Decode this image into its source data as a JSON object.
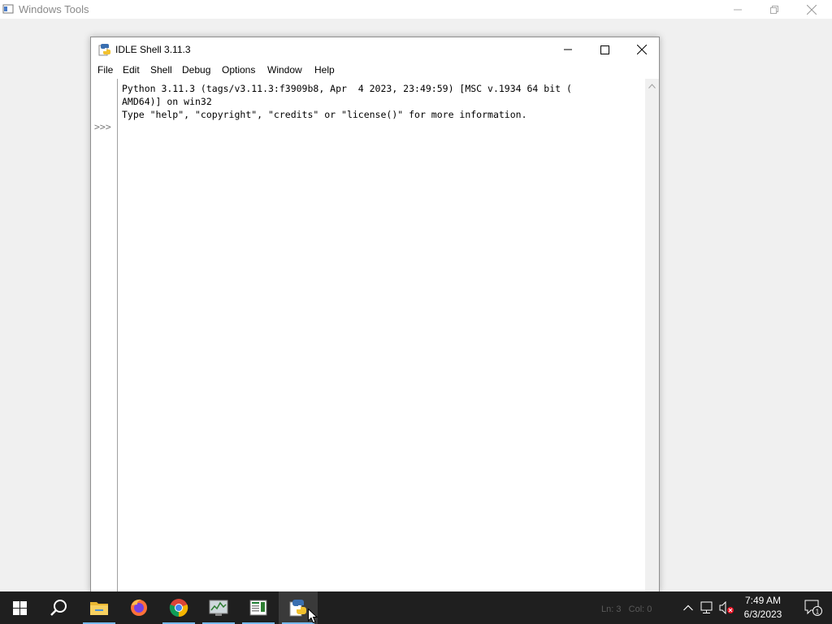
{
  "background_window": {
    "title": "Windows Tools",
    "icon": "windows-tools-icon"
  },
  "idle": {
    "title": "IDLE Shell 3.11.3",
    "icon": "python-idle-icon",
    "menu": [
      "File",
      "Edit",
      "Shell",
      "Debug",
      "Options",
      "Window",
      "Help"
    ],
    "prompt": ">>>",
    "output": "Python 3.11.3 (tags/v3.11.3:f3909b8, Apr  4 2023, 23:49:59) [MSC v.1934 64 bit (\nAMD64)] on win32\nType \"help\", \"copyright\", \"credits\" or \"license()\" for more information.",
    "status_ln": "Ln: 3",
    "status_col": "Col: 0"
  },
  "taskbar": {
    "apps": [
      {
        "name": "start",
        "icon": "windows-logo-icon"
      },
      {
        "name": "search",
        "icon": "search-icon"
      },
      {
        "name": "file-explorer",
        "icon": "folder-icon"
      },
      {
        "name": "firefox",
        "icon": "firefox-icon"
      },
      {
        "name": "chrome",
        "icon": "chrome-icon"
      },
      {
        "name": "task-manager",
        "icon": "performance-monitor-icon"
      },
      {
        "name": "text-editor",
        "icon": "document-icon"
      },
      {
        "name": "idle",
        "icon": "python-icon"
      }
    ],
    "clock": {
      "time": "7:49 AM",
      "date": "6/3/2023"
    },
    "notification_count": "1"
  },
  "colors": {
    "taskbar": "#1f1f1f",
    "accent_underline": "#76b9ed",
    "desktop": "#f0f0f0"
  }
}
